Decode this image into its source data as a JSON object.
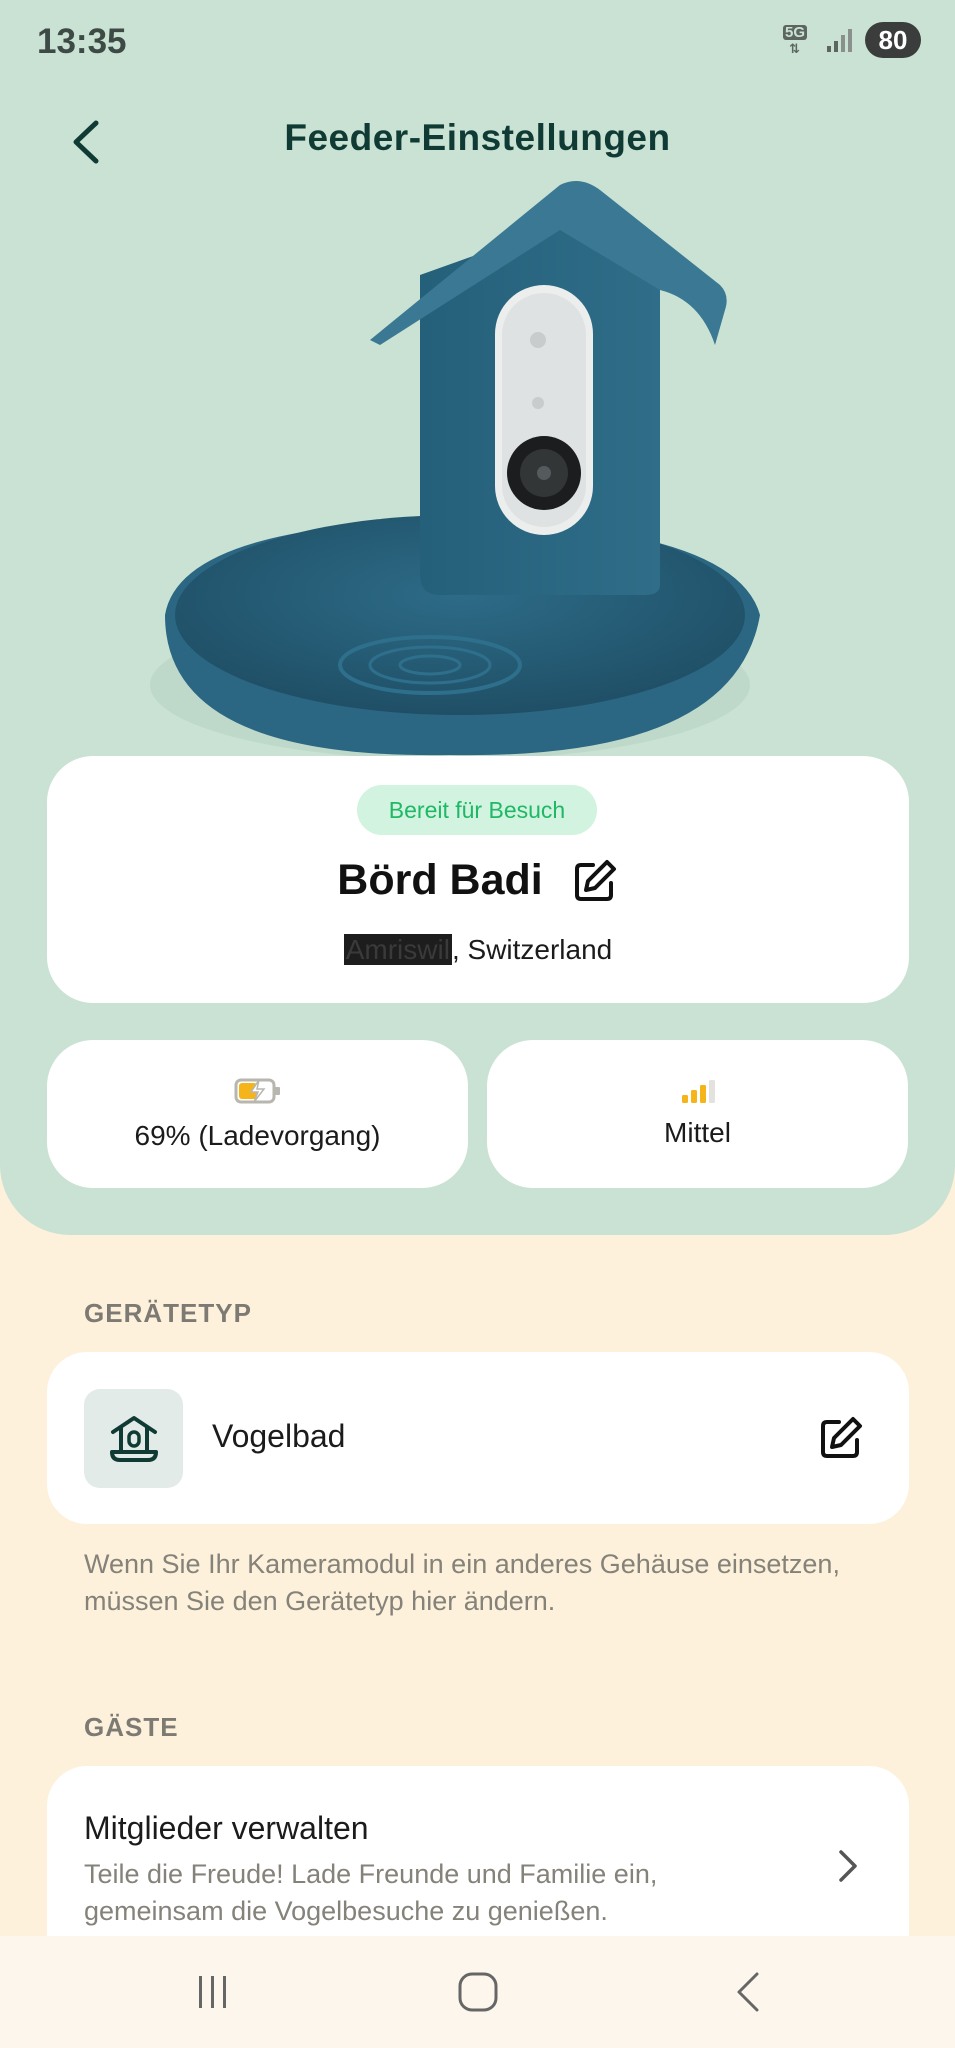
{
  "status_bar": {
    "time": "13:35",
    "network_label": "5G",
    "battery_level": "80"
  },
  "header": {
    "title": "Feeder-Einstellungen",
    "back_icon": "chevron-left-icon"
  },
  "device": {
    "status_badge": "Bereit für Besuch",
    "name": "Börd Badi",
    "location_redacted": "Amriswil",
    "location_rest": ", Switzerland",
    "edit_icon": "edit-icon"
  },
  "battery": {
    "text": "69% (Ladevorgang)",
    "icon": "battery-charging-icon",
    "level_fraction": 0.69
  },
  "signal": {
    "text": "Mittel",
    "icon": "signal-bars-icon",
    "bars_filled": 3,
    "bars_total": 4
  },
  "device_type_section": {
    "label": "GERÄTETYP",
    "type_name": "Vogelbad",
    "type_icon": "birdbath-icon",
    "helper": "Wenn Sie Ihr Kameramodul in ein anderes Gehäuse einsetzen, müssen Sie den Gerätetyp hier ändern."
  },
  "guests_section": {
    "label": "GÄSTE",
    "members_title": "Mitglieder verwalten",
    "members_subtitle": "Teile die Freude! Lade Freunde und Familie ein, gemeinsam die Vogelbesuche zu genießen."
  },
  "colors": {
    "hero_bg": "#c9e2d3",
    "page_bg": "#fdf1dc",
    "accent_green": "#1fb866",
    "title_color": "#0f3b34",
    "signal_yellow": "#f4b41a"
  }
}
